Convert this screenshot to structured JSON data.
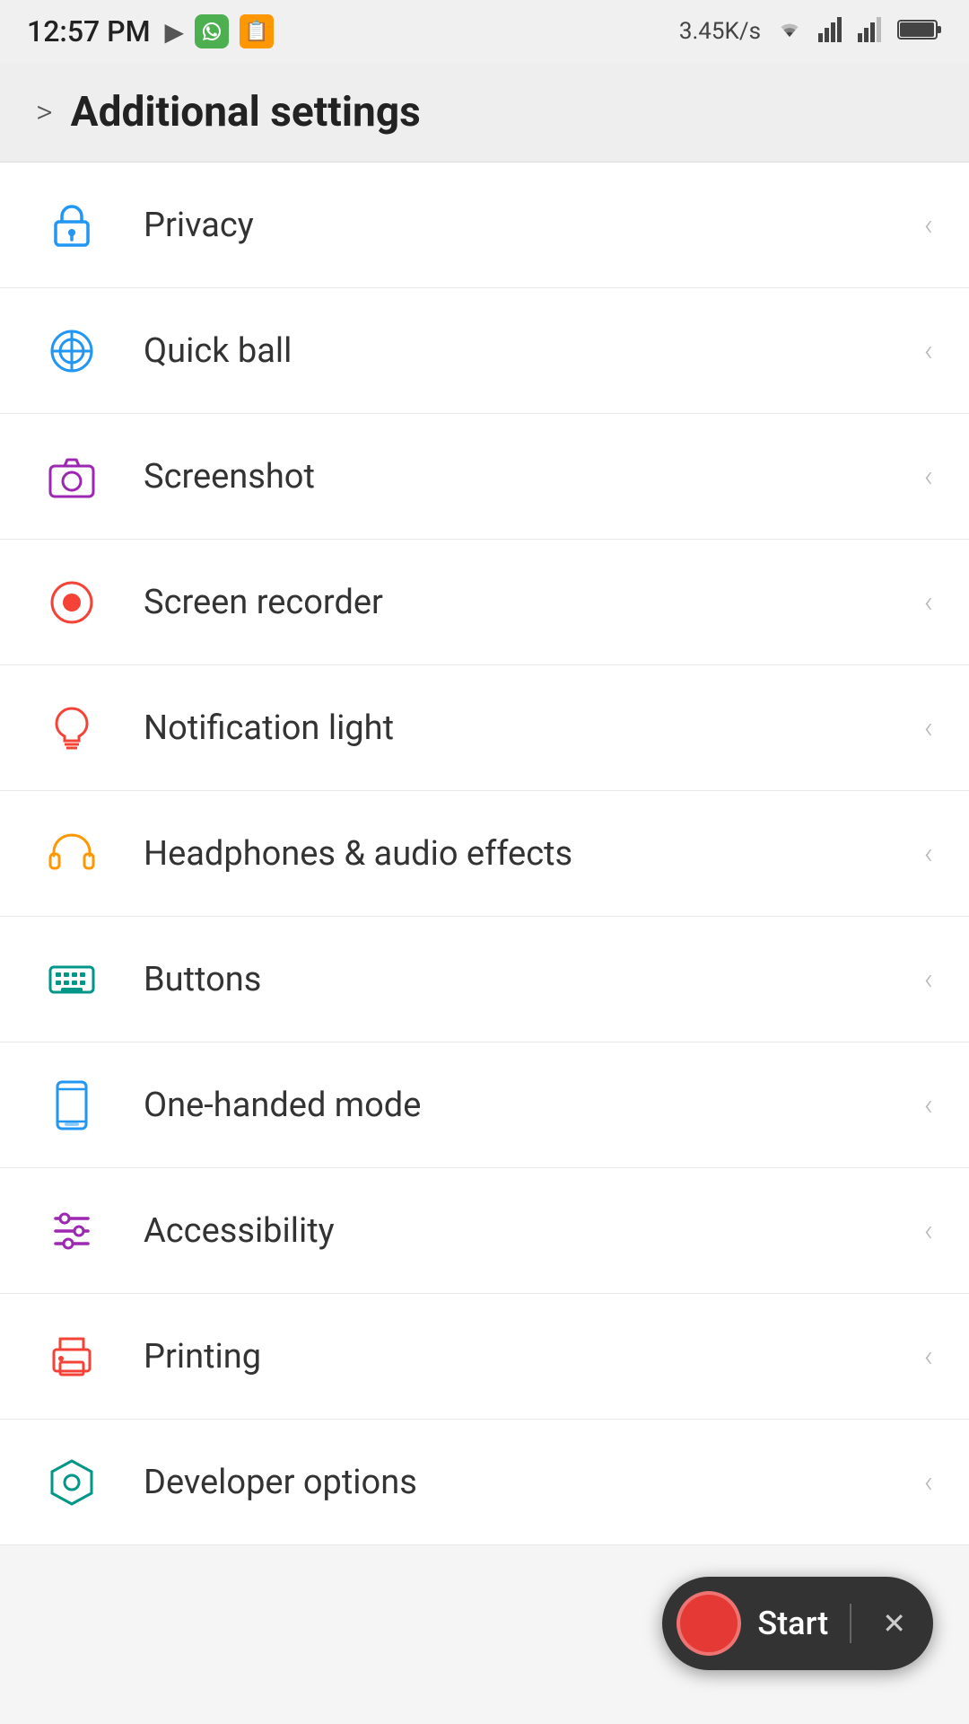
{
  "statusBar": {
    "time": "12:57 PM",
    "speed": "3.45K/s",
    "icons": {
      "play": "▶",
      "whatsapp": "W",
      "orange": "📋",
      "wifi": "WiFi",
      "signal1": "Signal",
      "signal2": "Signal",
      "battery": "Battery"
    }
  },
  "header": {
    "chevron": ">",
    "title": "Additional settings"
  },
  "items": [
    {
      "id": "privacy",
      "label": "Privacy",
      "iconColor": "#2196F3",
      "iconType": "lock"
    },
    {
      "id": "quickball",
      "label": "Quick ball",
      "iconColor": "#2196F3",
      "iconType": "target"
    },
    {
      "id": "screenshot",
      "label": "Screenshot",
      "iconColor": "#9C27B0",
      "iconType": "camera"
    },
    {
      "id": "screenrecorder",
      "label": "Screen recorder",
      "iconColor": "#f44336",
      "iconType": "record"
    },
    {
      "id": "notificationlight",
      "label": "Notification light",
      "iconColor": "#f44336",
      "iconType": "bulb"
    },
    {
      "id": "headphones",
      "label": "Headphones & audio effects",
      "iconColor": "#FF9800",
      "iconType": "headphones"
    },
    {
      "id": "buttons",
      "label": "Buttons",
      "iconColor": "#009688",
      "iconType": "keyboard"
    },
    {
      "id": "onehandedmode",
      "label": "One-handed mode",
      "iconColor": "#2196F3",
      "iconType": "phone"
    },
    {
      "id": "accessibility",
      "label": "Accessibility",
      "iconColor": "#9C27B0",
      "iconType": "sliders"
    },
    {
      "id": "printing",
      "label": "Printing",
      "iconColor": "#f44336",
      "iconType": "printer"
    },
    {
      "id": "developeroptions",
      "label": "Developer options",
      "iconColor": "#009688",
      "iconType": "hexagon"
    }
  ],
  "floatingRecord": {
    "label": "Start",
    "close": "✕"
  }
}
